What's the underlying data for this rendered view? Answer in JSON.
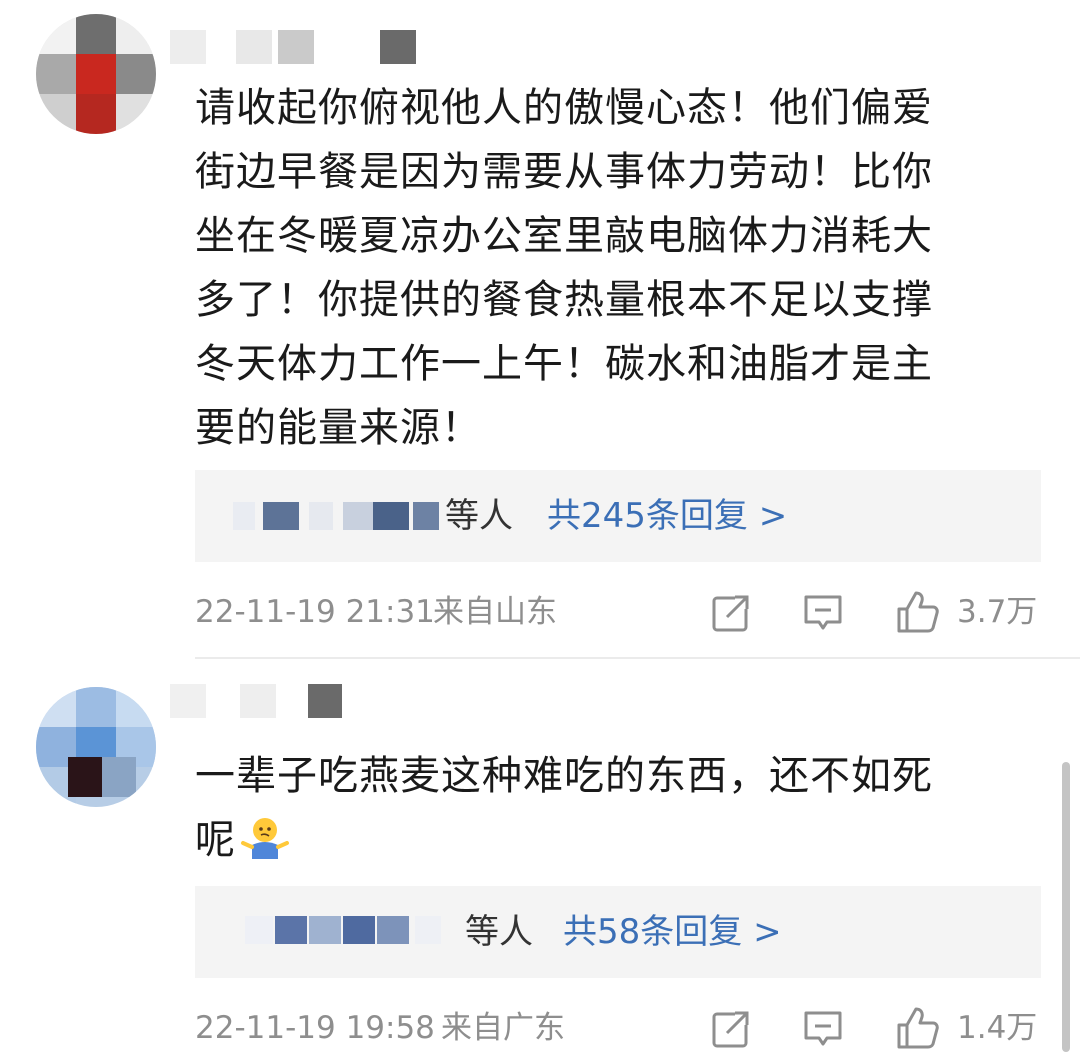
{
  "comments": [
    {
      "text_lines": [
        "请收起你俯视他人的傲慢心态！他们偏爱",
        "街边早餐是因为需要从事体力劳动！比你",
        "坐在冬暖夏凉办公室里敲电脑体力消耗大",
        "多了！你提供的餐食热量根本不足以支撑",
        "冬天体力工作一上午！碳水和油脂才是主",
        "要的能量来源！"
      ],
      "reply_suffix": "等人",
      "reply_count": "共245条回复 >",
      "timestamp": "22-11-19 21:31",
      "location": "来自山东",
      "likes": "3.7万"
    },
    {
      "text_lines": [
        "一辈子吃燕麦这种难吃的东西，还不如死",
        "呢"
      ],
      "emoji": "shrug-emoji",
      "reply_suffix": "等人",
      "reply_count": "共58条回复 >",
      "timestamp": "22-11-19 19:58",
      "location": "来自广东",
      "likes": "1.4万"
    }
  ],
  "icons": {
    "share": "share-icon",
    "comment": "comment-icon",
    "like": "like-icon"
  },
  "colors": {
    "link_blue": "#3b6fb6",
    "meta_gray": "#8e8e8e",
    "reply_bg": "#f4f4f4"
  }
}
